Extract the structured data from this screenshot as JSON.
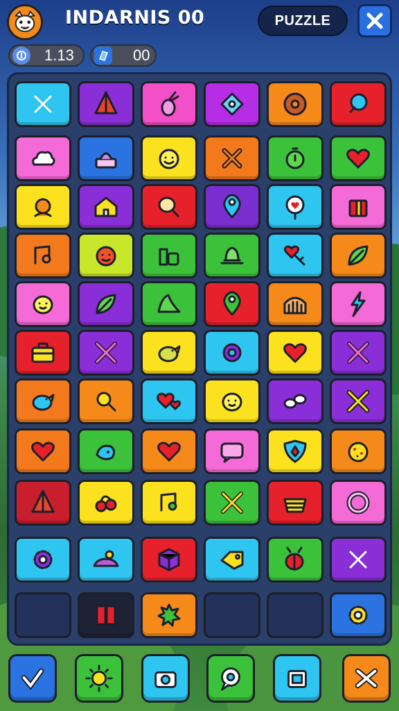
{
  "header": {
    "title": "INDARNIS 00",
    "mode_button": "PUZZLE",
    "stats": [
      {
        "icon": "coin-icon",
        "value": "1.13"
      },
      {
        "icon": "gem-icon",
        "value": "00"
      }
    ]
  },
  "board": {
    "rows": [
      [
        {
          "color": "#2ec6f0",
          "icon": "cross-icon"
        },
        {
          "color": "#8a2ed8",
          "icon": "pyramid-icon"
        },
        {
          "color": "#f24fc8",
          "icon": "radish-icon"
        },
        {
          "color": "#b52ee6",
          "icon": "diamond-icon"
        },
        {
          "color": "#f58a1a",
          "icon": "donut-icon"
        },
        {
          "color": "#e6212b",
          "icon": "candy-icon"
        }
      ],
      [
        {
          "color": "#f46ad6",
          "icon": "cloud-icon"
        },
        {
          "color": "#2a73e0",
          "icon": "cake-icon"
        },
        {
          "color": "#fce21e",
          "icon": "smiley-icon"
        },
        {
          "color": "#f37a1c",
          "icon": "bone-cross-icon"
        },
        {
          "color": "#3cc23a",
          "icon": "stopwatch-icon"
        },
        {
          "color": "#3cc23a",
          "icon": "heart-icon"
        }
      ],
      [
        {
          "color": "#fce21e",
          "icon": "face-icon"
        },
        {
          "color": "#8a2ed8",
          "icon": "house-icon"
        },
        {
          "color": "#e6212b",
          "icon": "meat-icon"
        },
        {
          "color": "#7a2ed0",
          "icon": "map-pin-icon"
        },
        {
          "color": "#2ec6f0",
          "icon": "heart-pin-icon"
        },
        {
          "color": "#f46ad6",
          "icon": "gift-icon"
        }
      ],
      [
        {
          "color": "#f37a1c",
          "icon": "music-note-icon"
        },
        {
          "color": "#c8e62a",
          "icon": "tomato-face-icon"
        },
        {
          "color": "#3cc23a",
          "icon": "gears-block-icon"
        },
        {
          "color": "#3cc23a",
          "icon": "temple-icon"
        },
        {
          "color": "#2ec6f0",
          "icon": "heart-key-icon"
        },
        {
          "color": "#f58a1a",
          "icon": "leaf-icon"
        }
      ],
      [
        {
          "color": "#f46ad6",
          "icon": "lemon-face-icon"
        },
        {
          "color": "#8a2ed8",
          "icon": "leaf-icon"
        },
        {
          "color": "#3cc23a",
          "icon": "mountain-icon"
        },
        {
          "color": "#e6212b",
          "icon": "map-pin-icon"
        },
        {
          "color": "#f58a1a",
          "icon": "gate-icon"
        },
        {
          "color": "#f46ad6",
          "icon": "lightning-icon"
        }
      ],
      [
        {
          "color": "#e6212b",
          "icon": "toolbox-icon"
        },
        {
          "color": "#8a2ed8",
          "icon": "crossed-arrows-icon"
        },
        {
          "color": "#fce21e",
          "icon": "bird-icon"
        },
        {
          "color": "#2ec6f0",
          "icon": "gear-ring-icon"
        },
        {
          "color": "#fce21e",
          "icon": "heart-icon"
        },
        {
          "color": "#8a2ed8",
          "icon": "crossed-arrows-icon"
        }
      ],
      [
        {
          "color": "#f37a1c",
          "icon": "bird-icon"
        },
        {
          "color": "#f58a1a",
          "icon": "magnifier-icon"
        },
        {
          "color": "#2ec6f0",
          "icon": "hearts-icon"
        },
        {
          "color": "#fce21e",
          "icon": "lemon-face-icon"
        },
        {
          "color": "#8a2ed8",
          "icon": "link-icon"
        },
        {
          "color": "#8a2ed8",
          "icon": "crossed-bones-icon"
        }
      ],
      [
        {
          "color": "#f37a1c",
          "icon": "heart-icon"
        },
        {
          "color": "#3cc23a",
          "icon": "fish-icon"
        },
        {
          "color": "#f58a1a",
          "icon": "heart-icon"
        },
        {
          "color": "#f46ad6",
          "icon": "chat-icon"
        },
        {
          "color": "#fce21e",
          "icon": "shield-icon"
        },
        {
          "color": "#f58a1a",
          "icon": "cookie-icon"
        }
      ],
      [
        {
          "color": "#c81e2e",
          "icon": "pyramid-icon"
        },
        {
          "color": "#fce21e",
          "icon": "cherry-icon"
        },
        {
          "color": "#fce21e",
          "icon": "music-note-icon"
        },
        {
          "color": "#3cc23a",
          "icon": "crossed-swords-icon"
        },
        {
          "color": "#e6212b",
          "icon": "basket-icon"
        },
        {
          "color": "#f46ad6",
          "icon": "ring-icon"
        }
      ],
      [
        {
          "color": "#2ec6f0",
          "icon": "gear-icon"
        },
        {
          "color": "#2ec6f0",
          "icon": "island-icon"
        },
        {
          "color": "#e6212b",
          "icon": "cube-icon"
        },
        {
          "color": "#2ec6f0",
          "icon": "tag-icon"
        },
        {
          "color": "#3cc23a",
          "icon": "beetle-icon"
        },
        {
          "color": "#8a2ed8",
          "icon": "cross-icon"
        }
      ],
      [
        {
          "color": "empty",
          "icon": ""
        },
        {
          "color": "#1e2235",
          "icon": "book-icon"
        },
        {
          "color": "#f58a1a",
          "icon": "splat-icon"
        },
        {
          "color": "empty",
          "icon": ""
        },
        {
          "color": "empty",
          "icon": ""
        },
        {
          "color": "#2a73e0",
          "icon": "gear-icon"
        }
      ]
    ]
  },
  "toolbar": {
    "buttons": [
      {
        "name": "checkmark-button",
        "icon": "check-icon",
        "color": "#2a73e0"
      },
      {
        "name": "sun-button",
        "icon": "sun-icon",
        "color": "#3cc23a"
      },
      {
        "name": "camera-button",
        "icon": "camera-icon",
        "color": "#2ec6f0"
      },
      {
        "name": "chat-button",
        "icon": "chat-bubble-icon",
        "color": "#3cc23a"
      },
      {
        "name": "box-button",
        "icon": "box-icon",
        "color": "#2ec6f0"
      },
      {
        "name": "shuffle-button",
        "icon": "shuffle-icon",
        "color": "#f58a1a"
      }
    ]
  }
}
